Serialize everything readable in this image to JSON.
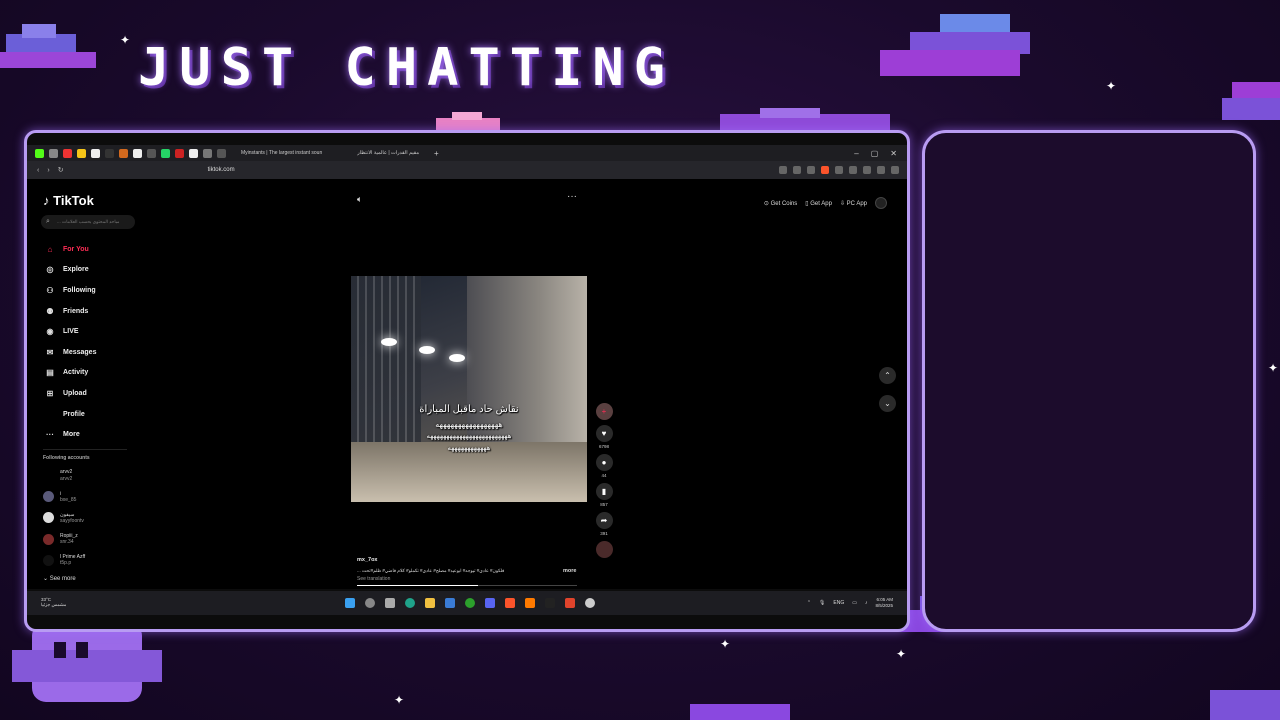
{
  "overlay": {
    "title": "JUST CHATTING"
  },
  "browser": {
    "tabs": [
      {
        "label": "Myinstants | The largest instant soun"
      },
      {
        "label": "مقيم القدرات | عالمية الانتظار"
      }
    ],
    "url": "tiktok.com",
    "window_controls": [
      "–",
      "▢",
      "✕"
    ]
  },
  "tiktok": {
    "logo": "TikTok",
    "search_placeholder": "... مباحد المحتوى بحسب العلامات",
    "nav": [
      {
        "label": "For You",
        "icon": "home-icon",
        "glyph": "⌂",
        "active": true
      },
      {
        "label": "Explore",
        "icon": "compass-icon",
        "glyph": "◎"
      },
      {
        "label": "Following",
        "icon": "following-icon",
        "glyph": "⚇"
      },
      {
        "label": "Friends",
        "icon": "friends-icon",
        "glyph": "⚉"
      },
      {
        "label": "LIVE",
        "icon": "live-icon",
        "glyph": "◉"
      },
      {
        "label": "Messages",
        "icon": "messages-icon",
        "glyph": "✉"
      },
      {
        "label": "Activity",
        "icon": "activity-icon",
        "glyph": "▤"
      },
      {
        "label": "Upload",
        "icon": "upload-icon",
        "glyph": "⊞"
      },
      {
        "label": "Profile",
        "icon": "profile-icon",
        "glyph": ""
      },
      {
        "label": "More",
        "icon": "more-icon",
        "glyph": "···"
      }
    ],
    "following_title": "Following accounts",
    "following": [
      {
        "name": "arvv2",
        "handle": "arvv2"
      },
      {
        "name": "i",
        "handle": "bxe_85"
      },
      {
        "name": "سيفون",
        "handle": "sayyfoontv"
      },
      {
        "name": "Ropiii_z",
        "handle": "snr.34"
      },
      {
        "name": "l Prime Azff",
        "handle": "t5p.p"
      }
    ],
    "see_more": "See more",
    "header_buttons": [
      {
        "label": "⊙ Get Coins"
      },
      {
        "label": "▯ Get App"
      },
      {
        "label": "⇩ PC App"
      }
    ],
    "video": {
      "caption_line1": "نقاش حاد ماقبل المباراة",
      "caption_line2": "هههههههههههههههههه",
      "caption_line3": "هههههههههههههههههههههههههه",
      "caption_line4": "ههههههههههههه"
    },
    "actions": [
      {
        "name": "avatar-follow",
        "glyph": "+",
        "count": ""
      },
      {
        "name": "like",
        "glyph": "♥",
        "count": "6798"
      },
      {
        "name": "comment",
        "glyph": "●",
        "count": "44"
      },
      {
        "name": "bookmark",
        "glyph": "▮",
        "count": "857"
      },
      {
        "name": "share",
        "glyph": "➦",
        "count": "391"
      }
    ],
    "post": {
      "username": "mx_7ox",
      "description": "... فلكون# عادي# تيوجه# ابوعيد# مصلح# عادي# تكملو# كلام فاضي# ظلم#تحت",
      "more": "more",
      "see_translation": "See translation",
      "progress": 0.55
    }
  },
  "taskbar": {
    "weather_temp": "33°C",
    "weather_desc": "مشمس جزئيا",
    "lang": "ENG",
    "time": "6:05 AM",
    "date": "8/5/2025"
  }
}
